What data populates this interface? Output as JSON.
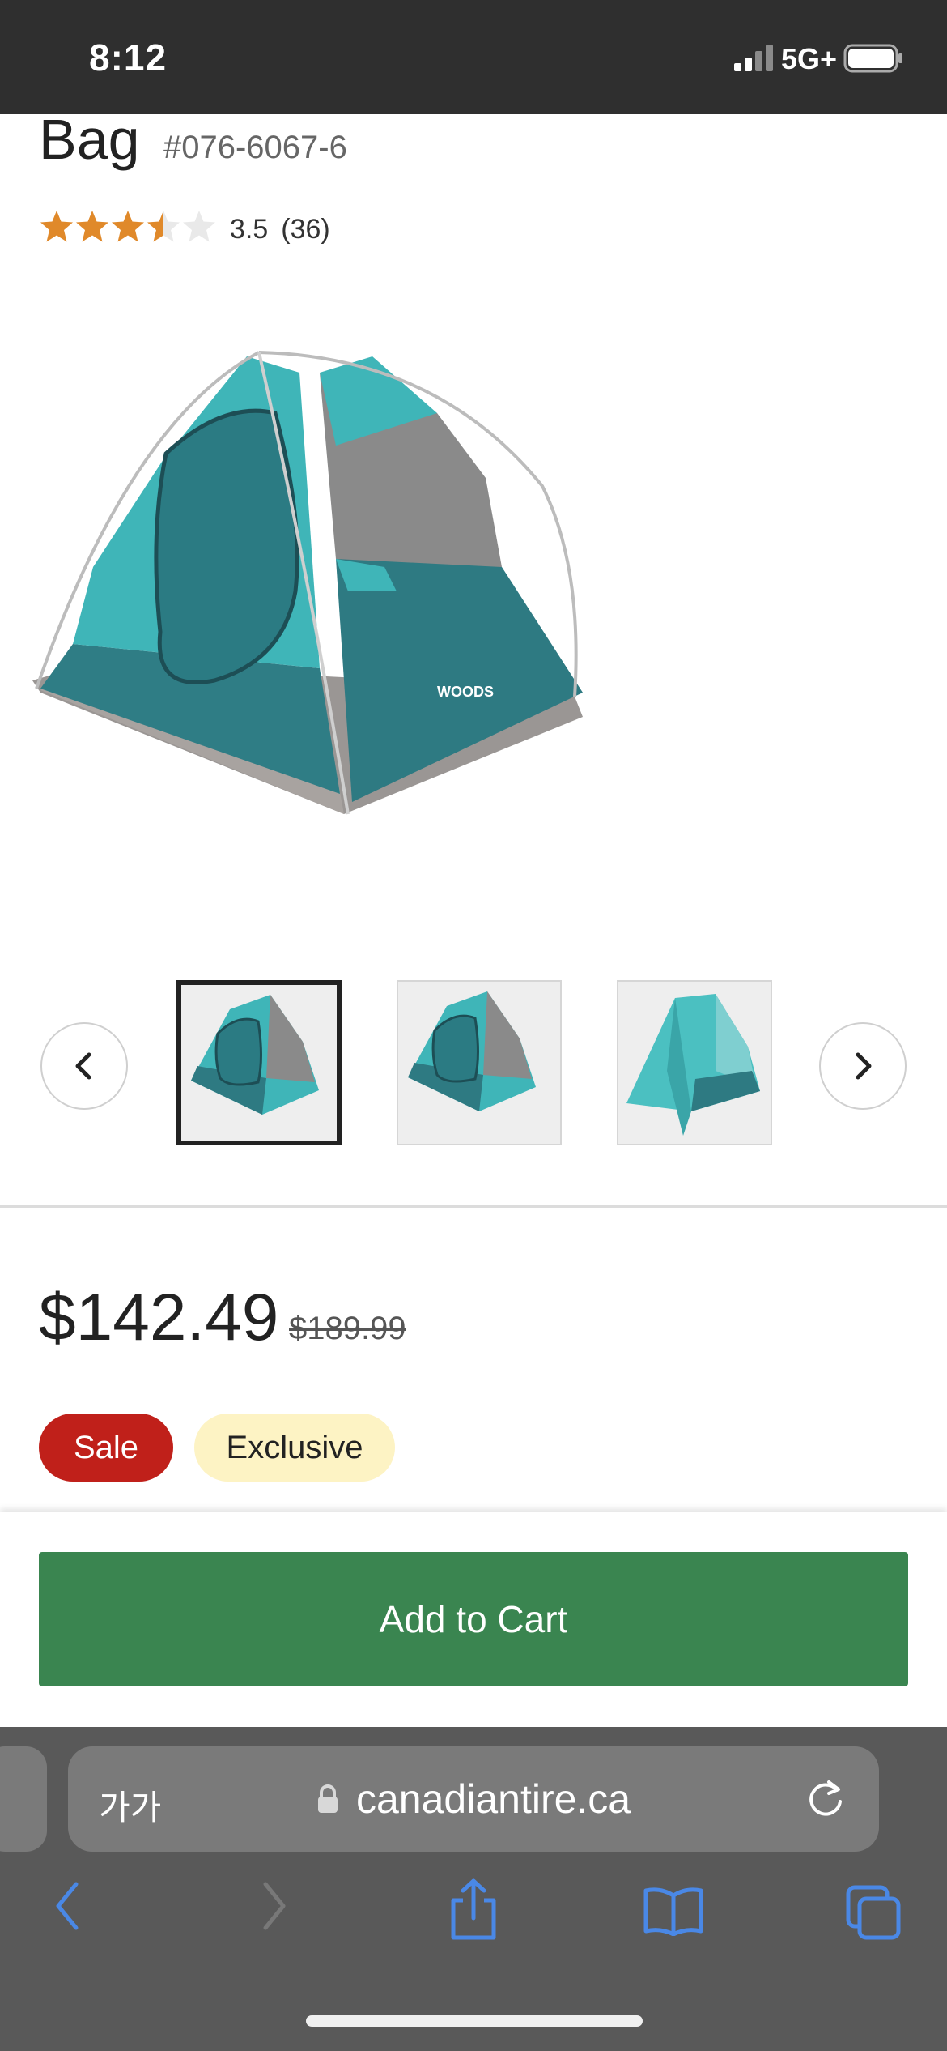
{
  "status_bar": {
    "time": "8:12",
    "network": "5G+"
  },
  "product": {
    "title_fragment": "Bag",
    "sku": "#076-6067-6",
    "rating": 3.5,
    "rating_text": "3.5",
    "review_count_text": "(36)",
    "price": "$142.49",
    "was_price": "$189.99",
    "badges": {
      "sale": "Sale",
      "exclusive": "Exclusive"
    },
    "tent_logo_text": "WOODS"
  },
  "gallery": {
    "active_index": 0,
    "thumbnail_count": 3
  },
  "cart": {
    "button_label": "Add to Cart"
  },
  "browser": {
    "aa_label": "가가",
    "domain": "canadiantire.ca"
  },
  "colors": {
    "sale_red": "#c0201a",
    "exclusive_yellow": "#fdf3c4",
    "cart_green": "#3a8550",
    "star_gold": "#e0892a",
    "safari_blue": "#4a88e6"
  },
  "icons": {
    "prev": "chevron-left-icon",
    "next": "chevron-right-icon",
    "lock": "lock-icon",
    "reload": "reload-icon",
    "back": "back-arrow-icon",
    "forward": "forward-arrow-icon",
    "share": "share-icon",
    "bookmarks": "book-icon",
    "tabs": "tabs-icon"
  }
}
